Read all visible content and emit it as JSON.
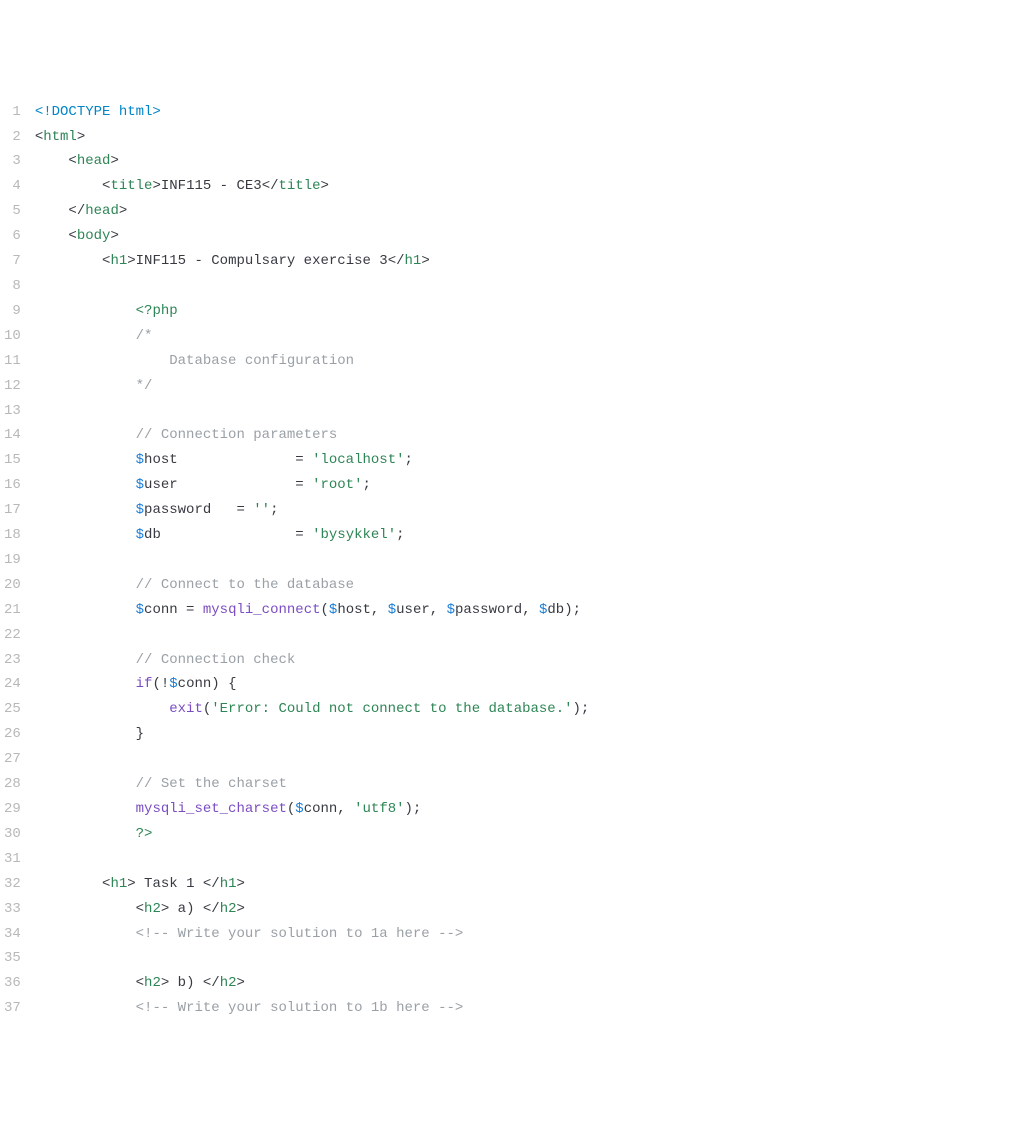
{
  "lines": [
    {
      "n": "1",
      "segs": [
        {
          "t": "<!DOCTYPE html>",
          "c": "doctype"
        }
      ],
      "indent": 0
    },
    {
      "n": "2",
      "segs": [
        {
          "t": "<",
          "c": "angle"
        },
        {
          "t": "html",
          "c": "tag"
        },
        {
          "t": ">",
          "c": "angle"
        }
      ],
      "indent": 0
    },
    {
      "n": "3",
      "segs": [
        {
          "t": "<",
          "c": "angle"
        },
        {
          "t": "head",
          "c": "tag"
        },
        {
          "t": ">",
          "c": "angle"
        }
      ],
      "indent": 1
    },
    {
      "n": "4",
      "segs": [
        {
          "t": "<",
          "c": "angle"
        },
        {
          "t": "title",
          "c": "tag"
        },
        {
          "t": ">",
          "c": "angle"
        },
        {
          "t": "INF115 - CE3",
          "c": "text"
        },
        {
          "t": "</",
          "c": "angle"
        },
        {
          "t": "title",
          "c": "tag"
        },
        {
          "t": ">",
          "c": "angle"
        }
      ],
      "indent": 2
    },
    {
      "n": "5",
      "segs": [
        {
          "t": "</",
          "c": "angle"
        },
        {
          "t": "head",
          "c": "tag"
        },
        {
          "t": ">",
          "c": "angle"
        }
      ],
      "indent": 1
    },
    {
      "n": "6",
      "segs": [
        {
          "t": "<",
          "c": "angle"
        },
        {
          "t": "body",
          "c": "tag"
        },
        {
          "t": ">",
          "c": "angle"
        }
      ],
      "indent": 1
    },
    {
      "n": "7",
      "segs": [
        {
          "t": "<",
          "c": "angle"
        },
        {
          "t": "h1",
          "c": "tag"
        },
        {
          "t": ">",
          "c": "angle"
        },
        {
          "t": "INF115 - Compulsary exercise 3",
          "c": "text"
        },
        {
          "t": "</",
          "c": "angle"
        },
        {
          "t": "h1",
          "c": "tag"
        },
        {
          "t": ">",
          "c": "angle"
        }
      ],
      "indent": 2
    },
    {
      "n": "8",
      "segs": [],
      "indent": 0
    },
    {
      "n": "9",
      "segs": [
        {
          "t": "<?php",
          "c": "php-open"
        }
      ],
      "indent": 3
    },
    {
      "n": "10",
      "segs": [
        {
          "t": "/*",
          "c": "comment"
        }
      ],
      "indent": 3
    },
    {
      "n": "11",
      "segs": [
        {
          "t": "    Database configuration",
          "c": "comment"
        }
      ],
      "indent": 3
    },
    {
      "n": "12",
      "segs": [
        {
          "t": "*/",
          "c": "comment"
        }
      ],
      "indent": 3
    },
    {
      "n": "13",
      "segs": [],
      "indent": 0
    },
    {
      "n": "14",
      "segs": [
        {
          "t": "// Connection parameters",
          "c": "comment"
        }
      ],
      "indent": 3
    },
    {
      "n": "15",
      "segs": [
        {
          "t": "$",
          "c": "var-sigil"
        },
        {
          "t": "host",
          "c": "var-name"
        },
        {
          "t": "              = ",
          "c": "op"
        },
        {
          "t": "'localhost'",
          "c": "string"
        },
        {
          "t": ";",
          "c": "punct"
        }
      ],
      "indent": 3
    },
    {
      "n": "16",
      "segs": [
        {
          "t": "$",
          "c": "var-sigil"
        },
        {
          "t": "user",
          "c": "var-name"
        },
        {
          "t": "              = ",
          "c": "op"
        },
        {
          "t": "'root'",
          "c": "string"
        },
        {
          "t": ";",
          "c": "punct"
        }
      ],
      "indent": 3
    },
    {
      "n": "17",
      "segs": [
        {
          "t": "$",
          "c": "var-sigil"
        },
        {
          "t": "password",
          "c": "var-name"
        },
        {
          "t": "   = ",
          "c": "op"
        },
        {
          "t": "''",
          "c": "string"
        },
        {
          "t": ";",
          "c": "punct"
        }
      ],
      "indent": 3
    },
    {
      "n": "18",
      "segs": [
        {
          "t": "$",
          "c": "var-sigil"
        },
        {
          "t": "db",
          "c": "var-name"
        },
        {
          "t": "                = ",
          "c": "op"
        },
        {
          "t": "'bysykkel'",
          "c": "string"
        },
        {
          "t": ";",
          "c": "punct"
        }
      ],
      "indent": 3
    },
    {
      "n": "19",
      "segs": [],
      "indent": 0
    },
    {
      "n": "20",
      "segs": [
        {
          "t": "// Connect to the database",
          "c": "comment"
        }
      ],
      "indent": 3
    },
    {
      "n": "21",
      "segs": [
        {
          "t": "$",
          "c": "var-sigil"
        },
        {
          "t": "conn",
          "c": "var-name"
        },
        {
          "t": " = ",
          "c": "op"
        },
        {
          "t": "mysqli_connect",
          "c": "func"
        },
        {
          "t": "(",
          "c": "punct"
        },
        {
          "t": "$",
          "c": "var-sigil"
        },
        {
          "t": "host",
          "c": "var-name"
        },
        {
          "t": ", ",
          "c": "punct"
        },
        {
          "t": "$",
          "c": "var-sigil"
        },
        {
          "t": "user",
          "c": "var-name"
        },
        {
          "t": ", ",
          "c": "punct"
        },
        {
          "t": "$",
          "c": "var-sigil"
        },
        {
          "t": "password",
          "c": "var-name"
        },
        {
          "t": ", ",
          "c": "punct"
        },
        {
          "t": "$",
          "c": "var-sigil"
        },
        {
          "t": "db",
          "c": "var-name"
        },
        {
          "t": ");",
          "c": "punct"
        }
      ],
      "indent": 3
    },
    {
      "n": "22",
      "segs": [],
      "indent": 0
    },
    {
      "n": "23",
      "segs": [
        {
          "t": "// Connection check",
          "c": "comment"
        }
      ],
      "indent": 3
    },
    {
      "n": "24",
      "segs": [
        {
          "t": "if",
          "c": "keyword"
        },
        {
          "t": "(!",
          "c": "punct"
        },
        {
          "t": "$",
          "c": "var-sigil"
        },
        {
          "t": "conn",
          "c": "var-name"
        },
        {
          "t": ") {",
          "c": "punct"
        }
      ],
      "indent": 3
    },
    {
      "n": "25",
      "segs": [
        {
          "t": "exit",
          "c": "func"
        },
        {
          "t": "(",
          "c": "punct"
        },
        {
          "t": "'Error: Could not connect to the database.'",
          "c": "string"
        },
        {
          "t": ");",
          "c": "punct"
        }
      ],
      "indent": 4
    },
    {
      "n": "26",
      "segs": [
        {
          "t": "}",
          "c": "punct"
        }
      ],
      "indent": 3
    },
    {
      "n": "27",
      "segs": [],
      "indent": 0
    },
    {
      "n": "28",
      "segs": [
        {
          "t": "// Set the charset",
          "c": "comment"
        }
      ],
      "indent": 3
    },
    {
      "n": "29",
      "segs": [
        {
          "t": "mysqli_set_charset",
          "c": "func"
        },
        {
          "t": "(",
          "c": "punct"
        },
        {
          "t": "$",
          "c": "var-sigil"
        },
        {
          "t": "conn",
          "c": "var-name"
        },
        {
          "t": ", ",
          "c": "punct"
        },
        {
          "t": "'utf8'",
          "c": "string"
        },
        {
          "t": ");",
          "c": "punct"
        }
      ],
      "indent": 3
    },
    {
      "n": "30",
      "segs": [
        {
          "t": "?>",
          "c": "php-open"
        }
      ],
      "indent": 3
    },
    {
      "n": "31",
      "segs": [],
      "indent": 0
    },
    {
      "n": "32",
      "segs": [
        {
          "t": "<",
          "c": "angle"
        },
        {
          "t": "h1",
          "c": "tag"
        },
        {
          "t": ">",
          "c": "angle"
        },
        {
          "t": " Task 1 ",
          "c": "text"
        },
        {
          "t": "</",
          "c": "angle"
        },
        {
          "t": "h1",
          "c": "tag"
        },
        {
          "t": ">",
          "c": "angle"
        }
      ],
      "indent": 2
    },
    {
      "n": "33",
      "segs": [
        {
          "t": "<",
          "c": "angle"
        },
        {
          "t": "h2",
          "c": "tag"
        },
        {
          "t": ">",
          "c": "angle"
        },
        {
          "t": " a) ",
          "c": "text"
        },
        {
          "t": "</",
          "c": "angle"
        },
        {
          "t": "h2",
          "c": "tag"
        },
        {
          "t": ">",
          "c": "angle"
        }
      ],
      "indent": 3
    },
    {
      "n": "34",
      "segs": [
        {
          "t": "<!-- Write your solution to 1a here -->",
          "c": "html-comment"
        }
      ],
      "indent": 3
    },
    {
      "n": "35",
      "segs": [],
      "indent": 0
    },
    {
      "n": "36",
      "segs": [
        {
          "t": "<",
          "c": "angle"
        },
        {
          "t": "h2",
          "c": "tag"
        },
        {
          "t": ">",
          "c": "angle"
        },
        {
          "t": " b) ",
          "c": "text"
        },
        {
          "t": "</",
          "c": "angle"
        },
        {
          "t": "h2",
          "c": "tag"
        },
        {
          "t": ">",
          "c": "angle"
        }
      ],
      "indent": 3
    },
    {
      "n": "37",
      "segs": [
        {
          "t": "<!-- Write your solution to 1b here -->",
          "c": "html-comment"
        }
      ],
      "indent": 3
    }
  ],
  "indent_unit": "    "
}
